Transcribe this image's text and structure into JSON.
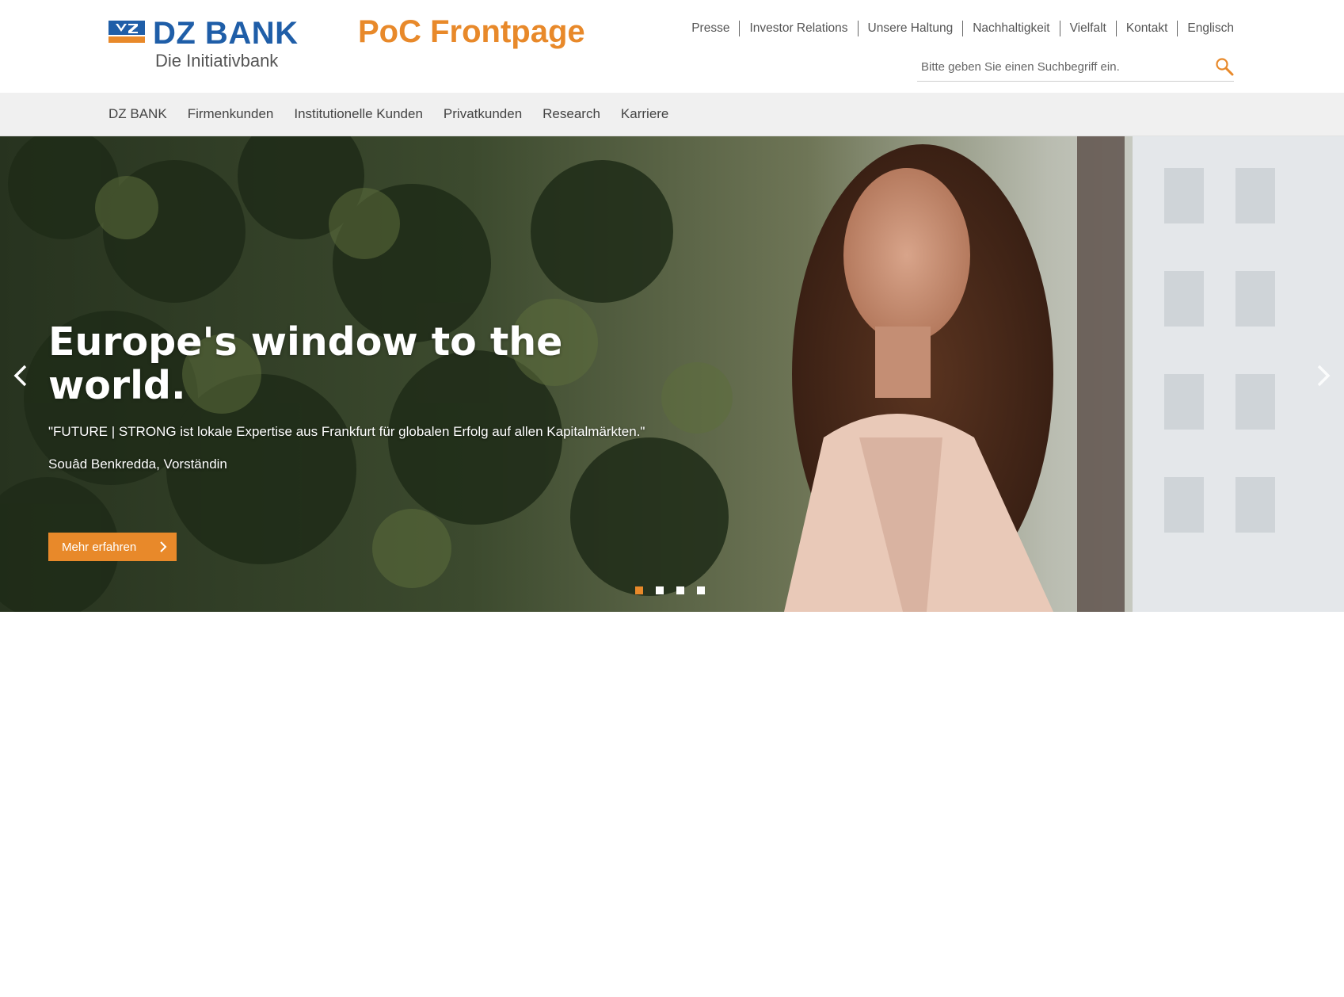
{
  "brand": {
    "name": "DZ BANK",
    "tagline": "Die Initiativbank",
    "site_title": "PoC Frontpage",
    "accent_color": "#e8892a",
    "brand_blue": "#1f5ea8"
  },
  "meta_nav": {
    "items": [
      {
        "label": "Presse"
      },
      {
        "label": "Investor Relations"
      },
      {
        "label": "Unsere Haltung"
      },
      {
        "label": "Nachhaltigkeit"
      },
      {
        "label": "Vielfalt"
      },
      {
        "label": "Kontakt"
      },
      {
        "label": "Englisch"
      }
    ]
  },
  "search": {
    "placeholder": "Bitte geben Sie einen Suchbegriff ein.",
    "value": "",
    "icon": "search-icon"
  },
  "main_nav": {
    "items": [
      {
        "label": "DZ BANK"
      },
      {
        "label": "Firmenkunden"
      },
      {
        "label": "Institutionelle Kunden"
      },
      {
        "label": "Privatkunden"
      },
      {
        "label": "Research"
      },
      {
        "label": "Karriere"
      }
    ]
  },
  "hero": {
    "headline": "Europe's window to the world.",
    "quote": "\"FUTURE | STRONG ist lokale Expertise aus Frankfurt für globalen Erfolg auf allen Kapitalmärkten.\"",
    "author": "Souâd Benkredda, Vorständin",
    "cta_label": "Mehr erfahren",
    "slide_count": 4,
    "active_slide": 1
  }
}
